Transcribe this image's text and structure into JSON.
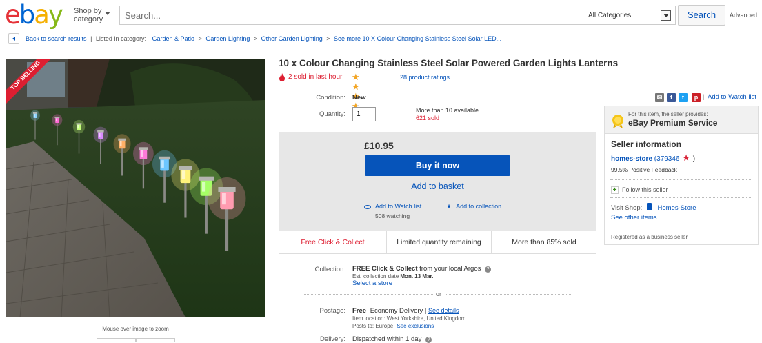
{
  "header": {
    "logo_letters": [
      {
        "ch": "e",
        "color": "#e53238"
      },
      {
        "ch": "b",
        "color": "#0064d2"
      },
      {
        "ch": "a",
        "color": "#f5af02"
      },
      {
        "ch": "y",
        "color": "#86b817"
      }
    ],
    "shop_by_line1": "Shop by",
    "shop_by_line2": "category",
    "search_placeholder": "Search...",
    "category_selected": "All Categories",
    "search_button": "Search",
    "advanced_link": "Advanced"
  },
  "breadcrumb": {
    "back": "Back to search results",
    "listed_in": "Listed in category:",
    "items": [
      "Garden & Patio",
      "Garden Lighting",
      "Other Garden Lighting",
      "See more 10 X Colour Changing Stainless Steel Solar LED..."
    ]
  },
  "image": {
    "ribbon": "TOP SELLING",
    "zoom_hint": "Mouse over image to zoom",
    "lantern_colors": [
      "#8fd3ff",
      "#ff6ad5",
      "#c6ff7a",
      "#d98bff",
      "#ffb066",
      "#ff7ad9",
      "#6cc6ff",
      "#fff27a",
      "#a6ff66",
      "#ff9bb0"
    ]
  },
  "product": {
    "title": "10 x Colour Changing Stainless Steel Solar Powered Garden Lights Lanterns",
    "sold_last_hour": "2 sold in last hour",
    "rating_stars": 3.5,
    "ratings_link": "28 product ratings",
    "condition_label": "Condition:",
    "condition_value": "New",
    "quantity_label": "Quantity:",
    "quantity_value": "1",
    "available": "More than 10 available",
    "sold_count": "621 sold",
    "price": "£10.95",
    "buy_now": "Buy it now",
    "add_to_basket": "Add to basket",
    "add_watch": "Add to Watch list",
    "watching": "508 watching",
    "add_collection": "Add to collection",
    "badges": [
      "Free Click & Collect",
      "Limited quantity remaining",
      "More than 85% sold"
    ]
  },
  "shipping": {
    "collection_label": "Collection:",
    "collection_bold": "FREE Click & Collect",
    "collection_rest": " from your local Argos",
    "est_prefix": "Est. collection date",
    "est_date": "Mon. 13 Mar.",
    "select_store": "Select a store",
    "or": "or",
    "postage_label": "Postage:",
    "postage_free": "Free",
    "postage_service": "Economy Delivery",
    "see_details": "See details",
    "item_location": "Item location:  West Yorkshire, United Kingdom",
    "posts_to": "Posts to:  Europe",
    "see_exclusions": "See exclusions",
    "delivery_label": "Delivery:",
    "delivery_value": "Dispatched within 1 day"
  },
  "seller": {
    "watchlist_link": "Add to Watch list",
    "premium_small": "For this item, the seller provides:",
    "premium_big": "eBay Premium Service",
    "info_title": "Seller information",
    "name": "homes-store",
    "score": "(379346",
    "score_close": ")",
    "feedback": "99.5% Positive Feedback",
    "follow": "Follow this seller",
    "visit_shop_label": "Visit Shop:",
    "shop_name": "Homes-Store",
    "other_items": "See other items",
    "registered": "Registered as a business seller"
  },
  "colors": {
    "link": "#0654ba",
    "red": "#dd1e31",
    "star": "#f5a623"
  }
}
